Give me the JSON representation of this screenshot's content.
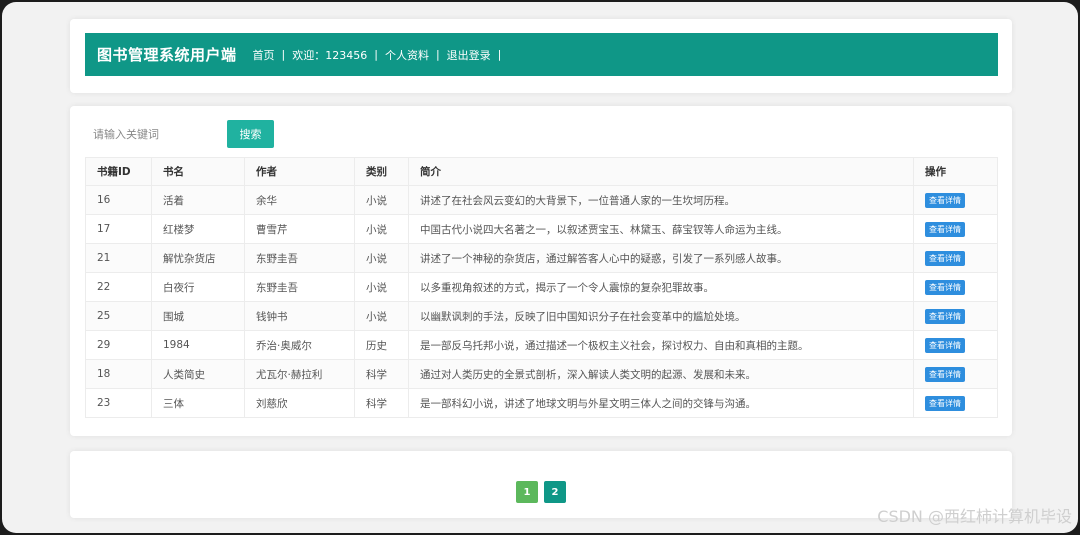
{
  "header": {
    "brand": "图书管理系统用户端",
    "nav": [
      {
        "label": "首页"
      },
      {
        "label": "欢迎：123456"
      },
      {
        "label": "个人资料"
      },
      {
        "label": "退出登录"
      }
    ],
    "separator": "|",
    "bg_color": "#0f9787"
  },
  "search": {
    "placeholder": "请输入关键词",
    "button_label": "搜索",
    "button_color": "#20b2a0"
  },
  "table": {
    "columns": [
      "书籍ID",
      "书名",
      "作者",
      "类别",
      "简介",
      "操作"
    ],
    "action_label": "查看详情",
    "rows": [
      {
        "id": "16",
        "title": "活着",
        "author": "余华",
        "category": "小说",
        "desc": "讲述了在社会风云变幻的大背景下，一位普通人家的一生坎坷历程。"
      },
      {
        "id": "17",
        "title": "红楼梦",
        "author": "曹雪芹",
        "category": "小说",
        "desc": "中国古代小说四大名著之一，以叙述贾宝玉、林黛玉、薛宝钗等人命运为主线。"
      },
      {
        "id": "21",
        "title": "解忧杂货店",
        "author": "东野圭吾",
        "category": "小说",
        "desc": "讲述了一个神秘的杂货店，通过解答客人心中的疑惑，引发了一系列感人故事。"
      },
      {
        "id": "22",
        "title": "白夜行",
        "author": "东野圭吾",
        "category": "小说",
        "desc": "以多重视角叙述的方式，揭示了一个令人震惊的复杂犯罪故事。"
      },
      {
        "id": "25",
        "title": "围城",
        "author": "钱钟书",
        "category": "小说",
        "desc": "以幽默讽刺的手法，反映了旧中国知识分子在社会变革中的尴尬处境。"
      },
      {
        "id": "29",
        "title": "1984",
        "author": "乔治·奥威尔",
        "category": "历史",
        "desc": "是一部反乌托邦小说，通过描述一个极权主义社会，探讨权力、自由和真相的主题。"
      },
      {
        "id": "18",
        "title": "人类简史",
        "author": "尤瓦尔·赫拉利",
        "category": "科学",
        "desc": "通过对人类历史的全景式剖析，深入解读人类文明的起源、发展和未来。"
      },
      {
        "id": "23",
        "title": "三体",
        "author": "刘慈欣",
        "category": "科学",
        "desc": "是一部科幻小说，讲述了地球文明与外星文明三体人之间的交锋与沟通。"
      }
    ]
  },
  "pagination": {
    "pages": [
      {
        "label": "1",
        "color": "#5cb85c"
      },
      {
        "label": "2",
        "color": "#0f9787"
      }
    ]
  },
  "watermark": "CSDN @西红柿计算机毕设"
}
